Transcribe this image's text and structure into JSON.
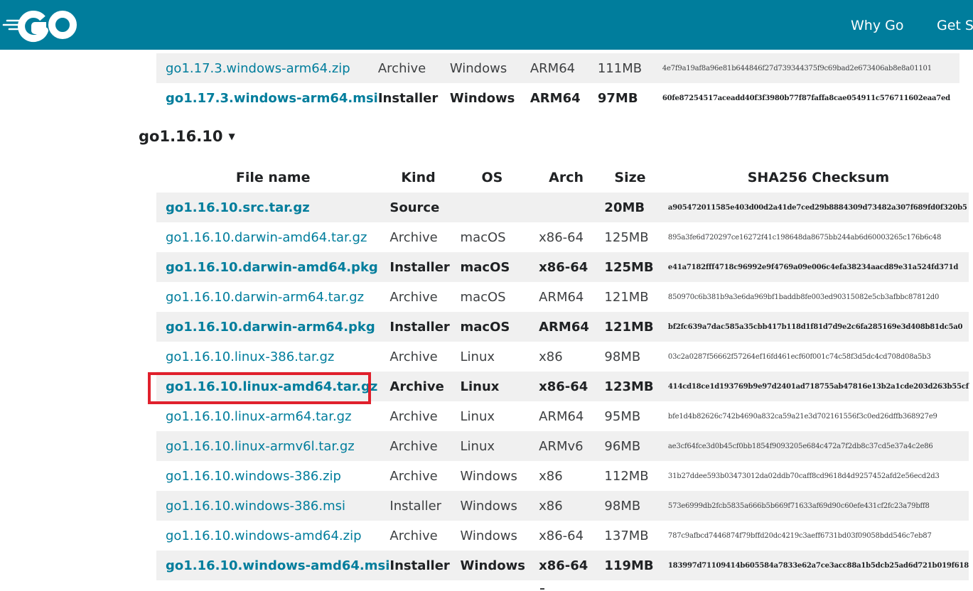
{
  "header": {
    "logo_icon": "go-logo-icon",
    "background": "#007d9c",
    "nav": [
      {
        "label": "Why Go"
      },
      {
        "label": "Get St"
      }
    ]
  },
  "prev_release_rows": [
    {
      "file": "go1.17.3.windows-arm64.zip",
      "kind": "Archive",
      "os": "Windows",
      "arch": "ARM64",
      "size": "111MB",
      "sha": "4e7f9a19af8a96e81b644846f27d739344375f9c69bad2e673406ab8e8a01101",
      "highlight": false,
      "shade": true
    },
    {
      "file": "go1.17.3.windows-arm64.msi",
      "kind": "Installer",
      "os": "Windows",
      "arch": "ARM64",
      "size": "97MB",
      "sha": "60fe87254517aceadd40f3f3980b77f87faffa8cae054911c576711602eaa7ed",
      "highlight": true,
      "shade": false
    }
  ],
  "release": {
    "version": "go1.16.10",
    "caret": "▼",
    "columns": {
      "file": "File name",
      "kind": "Kind",
      "os": "OS",
      "arch": "Arch",
      "size": "Size",
      "sha": "SHA256 Checksum"
    },
    "rows": [
      {
        "file": "go1.16.10.src.tar.gz",
        "kind": "Source",
        "os": "",
        "arch": "",
        "size": "20MB",
        "sha": "a905472011585e403d00d2a41de7ced29b8884309d73482a307f689fd0f320b5",
        "highlight": true,
        "shade": true
      },
      {
        "file": "go1.16.10.darwin-amd64.tar.gz",
        "kind": "Archive",
        "os": "macOS",
        "arch": "x86-64",
        "size": "125MB",
        "sha": "895a3fe6d720297ce16272f41c198648da8675bb244ab6d60003265c176b6c48",
        "highlight": false,
        "shade": false
      },
      {
        "file": "go1.16.10.darwin-amd64.pkg",
        "kind": "Installer",
        "os": "macOS",
        "arch": "x86-64",
        "size": "125MB",
        "sha": "e41a7182fff4718c96992e9f4769a09e006c4efa38234aacd89e31a524fd371d",
        "highlight": true,
        "shade": true
      },
      {
        "file": "go1.16.10.darwin-arm64.tar.gz",
        "kind": "Archive",
        "os": "macOS",
        "arch": "ARM64",
        "size": "121MB",
        "sha": "850970c6b381b9a3e6da969bf1baddb8fe003ed90315082e5cb3afbbc87812d0",
        "highlight": false,
        "shade": false
      },
      {
        "file": "go1.16.10.darwin-arm64.pkg",
        "kind": "Installer",
        "os": "macOS",
        "arch": "ARM64",
        "size": "121MB",
        "sha": "bf2fc639a7dac585a35cbb417b118d1f81d7d9e2c6fa285169e3d408b81dc5a0",
        "highlight": true,
        "shade": true
      },
      {
        "file": "go1.16.10.linux-386.tar.gz",
        "kind": "Archive",
        "os": "Linux",
        "arch": "x86",
        "size": "98MB",
        "sha": "03c2a0287f56662f57264ef16fd461ecf60f001c74c58f3d5dc4cd708d08a5b3",
        "highlight": false,
        "shade": false
      },
      {
        "file": "go1.16.10.linux-amd64.tar.gz",
        "kind": "Archive",
        "os": "Linux",
        "arch": "x86-64",
        "size": "123MB",
        "sha": "414cd18ce1d193769b9e97d2401ad718755ab47816e13b2a1cde203d263b55cf",
        "highlight": true,
        "shade": true
      },
      {
        "file": "go1.16.10.linux-arm64.tar.gz",
        "kind": "Archive",
        "os": "Linux",
        "arch": "ARM64",
        "size": "95MB",
        "sha": "bfe1d4b82626c742b4690a832ca59a21e3d702161556f3c0ed26dffb368927e9",
        "highlight": false,
        "shade": false
      },
      {
        "file": "go1.16.10.linux-armv6l.tar.gz",
        "kind": "Archive",
        "os": "Linux",
        "arch": "ARMv6",
        "size": "96MB",
        "sha": "ae3cf64fce3d0b45cf0bb1854f9093205e684c472a7f2db8c37cd5e37a4c2e86",
        "highlight": false,
        "shade": true
      },
      {
        "file": "go1.16.10.windows-386.zip",
        "kind": "Archive",
        "os": "Windows",
        "arch": "x86",
        "size": "112MB",
        "sha": "31b27ddee593b03473012da02ddb70caff8cd9618d4d9257452afd2e56ecd2d3",
        "highlight": false,
        "shade": false
      },
      {
        "file": "go1.16.10.windows-386.msi",
        "kind": "Installer",
        "os": "Windows",
        "arch": "x86",
        "size": "98MB",
        "sha": "573e6999db2fcb5835a666b5b669f71633af69d90c60efe431cf2fc23a79bff8",
        "highlight": false,
        "shade": true
      },
      {
        "file": "go1.16.10.windows-amd64.zip",
        "kind": "Archive",
        "os": "Windows",
        "arch": "x86-64",
        "size": "137MB",
        "sha": "787c9afbcd7446874f79bffd20dc4219c3aeff6731bd03f09058bdd546c7eb87",
        "highlight": false,
        "shade": false
      },
      {
        "file": "go1.16.10.windows-amd64.msi",
        "kind": "Installer",
        "os": "Windows",
        "arch": "x86-64",
        "size": "119MB",
        "sha": "183997d71109414b605584a7833e62a7ce3acc88a1b5dcb25ad6d721b019f618",
        "highlight": true,
        "shade": true
      }
    ]
  },
  "annotation": {
    "color": "#e0202c",
    "target": "go1.16.10.linux-amd64.tar.gz"
  }
}
